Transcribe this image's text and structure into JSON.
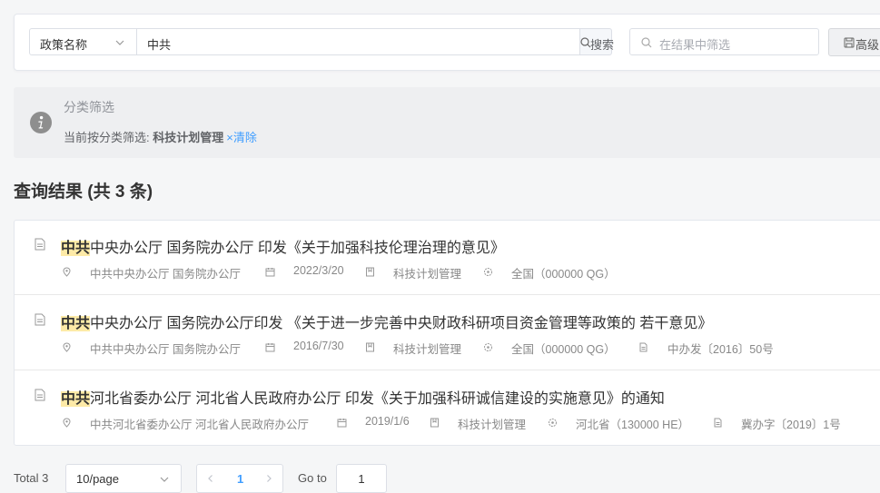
{
  "search": {
    "field_select": "政策名称",
    "keyword": "中共",
    "search_button": "搜索",
    "filter_placeholder": "在结果中筛选",
    "advanced_button": "高级"
  },
  "category_filter": {
    "title": "分类筛选",
    "prefix": "当前按分类筛选: ",
    "category": "科技计划管理",
    "remove": "×",
    "clear": "清除"
  },
  "results": {
    "heading": "查询结果 (共 3 条)",
    "items": [
      {
        "highlight": "中共",
        "title": "中央办公厅 国务院办公厅 印发《关于加强科技伦理治理的意见》",
        "issuer": "中共中央办公厅 国务院办公厅",
        "date": "2022/3/20",
        "category": "科技计划管理",
        "region": "全国（000000 QG）",
        "doc_no": ""
      },
      {
        "highlight": "中共",
        "title": "中央办公厅 国务院办公厅印发 《关于进一步完善中央财政科研项目资金管理等政策的 若干意见》",
        "issuer": "中共中央办公厅 国务院办公厅",
        "date": "2016/7/30",
        "category": "科技计划管理",
        "region": "全国（000000 QG）",
        "doc_no": "中办发〔2016〕50号"
      },
      {
        "highlight": "中共",
        "title": "河北省委办公厅 河北省人民政府办公厅 印发《关于加强科研诚信建设的实施意见》的通知",
        "issuer": "中共河北省委办公厅 河北省人民政府办公厅",
        "date": "2019/1/6",
        "category": "科技计划管理",
        "region": "河北省（130000 HE）",
        "doc_no": "冀办字〔2019〕1号"
      }
    ]
  },
  "pagination": {
    "total": "Total 3",
    "page_size": "10/page",
    "current_page": "1",
    "goto_label": "Go to",
    "goto_value": "1"
  },
  "colors": {
    "accent": "#409eff",
    "highlight": "#fdeaa7"
  }
}
